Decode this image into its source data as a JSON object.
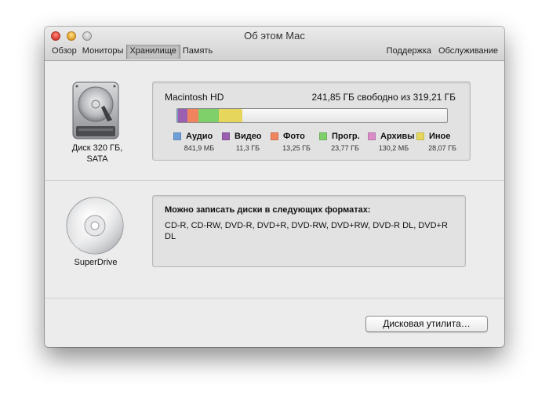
{
  "window": {
    "title": "Об этом Mac",
    "tabs_left": [
      {
        "label": "Обзор",
        "active": false
      },
      {
        "label": "Мониторы",
        "active": false
      },
      {
        "label": "Хранилище",
        "active": true
      },
      {
        "label": "Память",
        "active": false
      }
    ],
    "tabs_right": [
      {
        "label": "Поддержка"
      },
      {
        "label": "Обслуживание"
      }
    ]
  },
  "disk": {
    "label": "Диск 320 ГБ, SATA",
    "icon": "hard-drive-icon",
    "volume_name": "Macintosh HD",
    "free_text": "241,85 ГБ свободно из 319,21 ГБ",
    "total_gb": 319.21,
    "categories": [
      {
        "name": "Аудио",
        "size": "841,9 МБ",
        "gb": 0.84,
        "color": "#6f9fd8"
      },
      {
        "name": "Видео",
        "size": "11,3 ГБ",
        "gb": 11.3,
        "color": "#9b5fb0"
      },
      {
        "name": "Фото",
        "size": "13,25 ГБ",
        "gb": 13.25,
        "color": "#f0845e"
      },
      {
        "name": "Прогр.",
        "size": "23,77 ГБ",
        "gb": 23.77,
        "color": "#7fcf6a"
      },
      {
        "name": "Архивы",
        "size": "130,2 МБ",
        "gb": 0.13,
        "color": "#d98cc8"
      },
      {
        "name": "Иное",
        "size": "28,07 ГБ",
        "gb": 28.07,
        "color": "#e6d75c"
      }
    ]
  },
  "superdrive": {
    "label": "SuperDrive",
    "icon": "optical-disc-icon",
    "heading": "Можно записать диски в следующих форматах:",
    "formats": "CD-R, CD-RW, DVD-R, DVD+R, DVD-RW, DVD+RW, DVD-R DL, DVD+R DL"
  },
  "actions": {
    "disk_utility_label": "Дисковая утилита…"
  }
}
